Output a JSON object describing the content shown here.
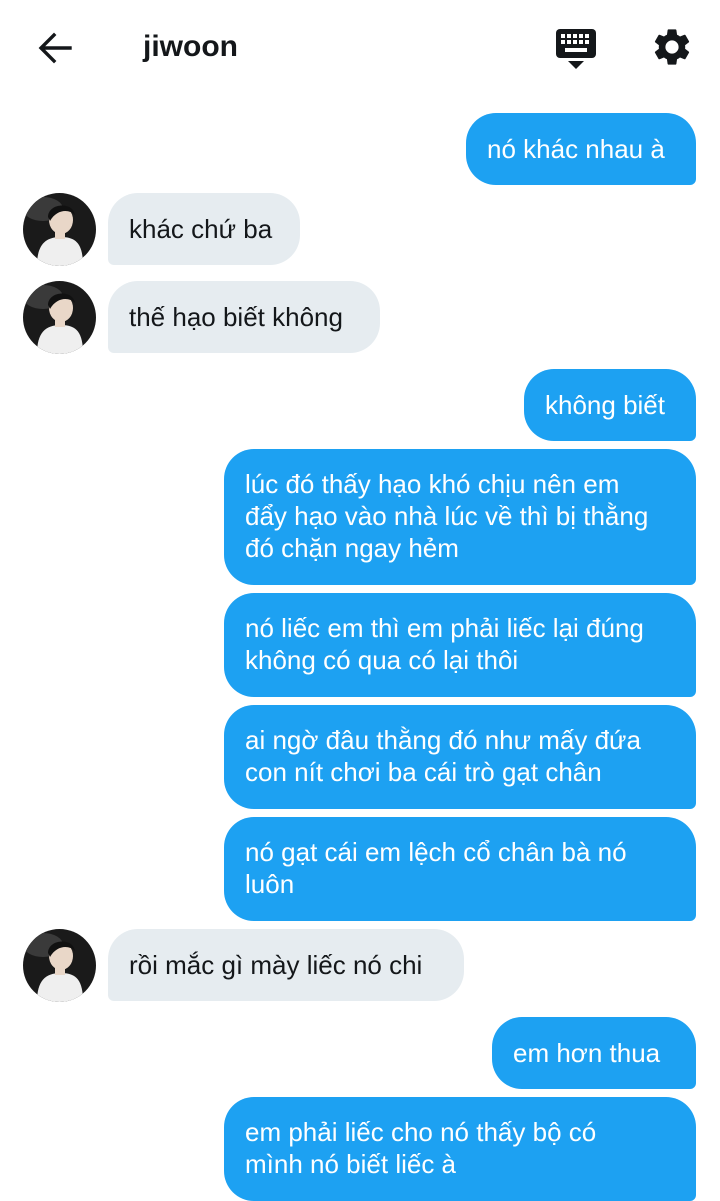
{
  "header": {
    "title": "jiwoon",
    "back_icon": "arrow-left-icon",
    "keyboard_icon": "keyboard-icon",
    "settings_icon": "gear-icon"
  },
  "colors": {
    "outgoing_bubble": "#1da1f2",
    "incoming_bubble": "#e6ecf0",
    "outgoing_text": "#ffffff",
    "incoming_text": "#14171a"
  },
  "messages": [
    {
      "direction": "out",
      "text": "nó khác nhau à"
    },
    {
      "direction": "in",
      "text": "khác chứ ba"
    },
    {
      "direction": "in",
      "text": "thế hạo biết không"
    },
    {
      "direction": "out",
      "text": "không biết"
    },
    {
      "direction": "out",
      "lines": [
        "lúc đó thấy hạo khó chịu nên em",
        "đẩy hạo vào nhà lúc về thì bị thằng",
        "đó chặn ngay hẻm"
      ]
    },
    {
      "direction": "out",
      "lines": [
        "nó liếc em thì em phải liếc lại đúng",
        "không có qua có lại thôi"
      ]
    },
    {
      "direction": "out",
      "lines": [
        "ai ngờ đâu thằng đó như mấy đứa",
        "con nít chơi ba cái trò gạt chân"
      ]
    },
    {
      "direction": "out",
      "lines": [
        "nó gạt cái em lệch cổ chân bà nó",
        "luôn"
      ]
    },
    {
      "direction": "in",
      "text": "rồi mắc gì mày liếc nó chi"
    },
    {
      "direction": "out",
      "text": "em hơn thua"
    },
    {
      "direction": "out",
      "lines": [
        "em phải liếc cho nó thấy bộ có",
        "mình nó biết liếc à"
      ]
    }
  ]
}
